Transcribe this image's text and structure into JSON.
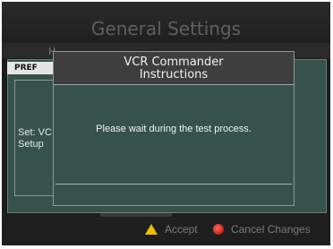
{
  "header": {
    "title": "General Settings"
  },
  "tabs": {
    "partial_letter": "H",
    "active_tab": "PREF"
  },
  "panel": {
    "setup_line1": "Set: VC",
    "setup_line2": "Setup"
  },
  "dialog": {
    "title_line1": "VCR Commander",
    "title_line2": "Instructions",
    "message": "Please wait during the test process."
  },
  "footer": {
    "accept_label": "Accept",
    "accept_icon": "yellow-triangle-icon",
    "cancel_label": "Cancel Changes",
    "cancel_icon": "red-circle-icon"
  },
  "colors": {
    "panel_teal": "#37524c",
    "accept_yellow": "#e6c000",
    "cancel_red": "#c4201b"
  }
}
